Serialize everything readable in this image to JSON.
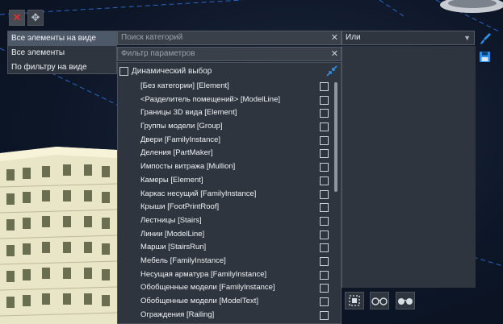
{
  "toolbar": {
    "close_icon": "close-icon",
    "move_icon": "move-icon"
  },
  "mode_menu": {
    "items": [
      {
        "label": "Все элементы на виде",
        "selected": true
      },
      {
        "label": "Все элементы",
        "selected": false
      },
      {
        "label": "По фильтру на виде",
        "selected": false
      }
    ]
  },
  "category_search": {
    "placeholder": "Поиск категорий",
    "value": ""
  },
  "parameter_filter": {
    "placeholder": "Фильтр параметров",
    "value": ""
  },
  "operator_select": {
    "value": "Или"
  },
  "dynamic_selection": {
    "label": "Динамический выбор",
    "checked": false
  },
  "categories": [
    {
      "label": "[Без категории] [Element]",
      "checked": false
    },
    {
      "label": "<Разделитель помещений> [ModelLine]",
      "checked": false
    },
    {
      "label": "Границы 3D вида [Element]",
      "checked": false
    },
    {
      "label": "Группы модели [Group]",
      "checked": false
    },
    {
      "label": "Двери [FamilyInstance]",
      "checked": false
    },
    {
      "label": "Деления [PartMaker]",
      "checked": false
    },
    {
      "label": "Импосты витража [Mullion]",
      "checked": false
    },
    {
      "label": "Камеры [Element]",
      "checked": false
    },
    {
      "label": "Каркас несущий [FamilyInstance]",
      "checked": false
    },
    {
      "label": "Крыши [FootPrintRoof]",
      "checked": false
    },
    {
      "label": "Лестницы [Stairs]",
      "checked": false
    },
    {
      "label": "Линии [ModelLine]",
      "checked": false
    },
    {
      "label": "Марши [StairsRun]",
      "checked": false
    },
    {
      "label": "Мебель [FamilyInstance]",
      "checked": false
    },
    {
      "label": "Несущая арматура [FamilyInstance]",
      "checked": false
    },
    {
      "label": "Обобщенные модели [FamilyInstance]",
      "checked": false
    },
    {
      "label": "Обобщенные модели [ModelText]",
      "checked": false
    },
    {
      "label": "Ограждения [Railing]",
      "checked": false
    }
  ],
  "colors": {
    "panel_bg": "#2f353e",
    "accent_blue": "#2f8ee6",
    "close_red": "#e03030"
  }
}
